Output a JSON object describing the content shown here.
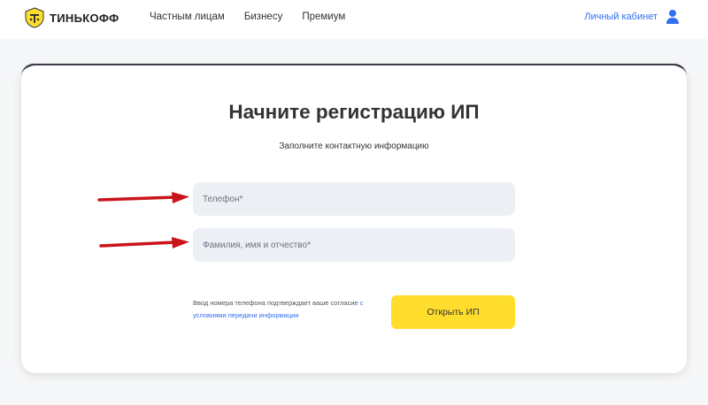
{
  "header": {
    "brand": "ТИНЬКОФФ",
    "nav": [
      {
        "label": "Частным лицам"
      },
      {
        "label": "Бизнесу"
      },
      {
        "label": "Премиум"
      }
    ],
    "account_label": "Личный кабинет",
    "icons": {
      "logo": "tinkoff-emblem-icon",
      "account": "user-icon"
    }
  },
  "form": {
    "title": "Начните регистрацию ИП",
    "subtitle": "Заполните контактную информацию",
    "phone": {
      "value": "",
      "placeholder": "Телефон*"
    },
    "full_name": {
      "value": "",
      "placeholder": "Фамилия, имя и отчество*"
    },
    "consent_text": "Ввод номера телефона подтверждает ваше согласие ",
    "consent_link": "с условиями передачи информации",
    "submit_label": "Открыть ИП"
  },
  "colors": {
    "accent_yellow": "#ffdd2d",
    "link_blue": "#336fee",
    "field_bg": "#eceff4",
    "annotation_red": "#c9141b"
  }
}
